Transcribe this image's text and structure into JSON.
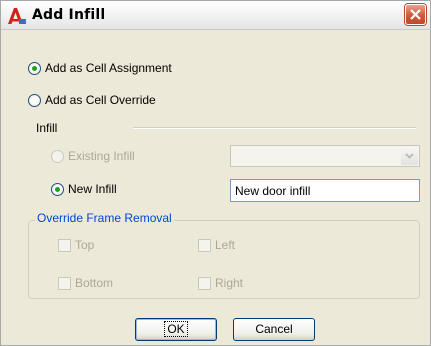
{
  "window": {
    "title": "Add Infill",
    "icon": "autocad-a-icon",
    "close_icon": "close-x-icon"
  },
  "assignment": {
    "cell_assignment_label": "Add as Cell Assignment",
    "cell_override_label": "Add as Cell Override",
    "selected": "cell_assignment"
  },
  "infill": {
    "section_label": "Infill",
    "existing_label": "Existing Infill",
    "existing_value": "",
    "new_label": "New Infill",
    "new_value": "New door infill",
    "selected": "new"
  },
  "override": {
    "legend": "Override Frame Removal",
    "top_label": "Top",
    "left_label": "Left",
    "bottom_label": "Bottom",
    "right_label": "Right"
  },
  "buttons": {
    "ok_label": "OK",
    "cancel_label": "Cancel"
  },
  "colors": {
    "accent_group_legend": "#0046d5",
    "radio_selected": "#21a121",
    "close_button": "#d0593a"
  }
}
